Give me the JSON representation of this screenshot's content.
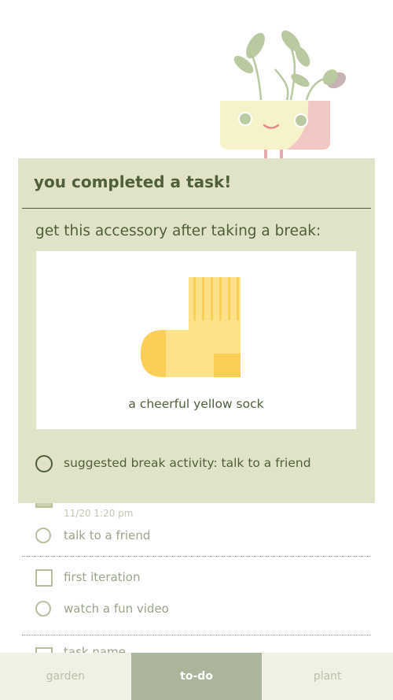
{
  "modal": {
    "title": "you completed a task!",
    "subtitle": "get this accessory after taking a break:",
    "accessory_name": "a cheerful yellow sock",
    "suggestion": "suggested break activity: talk to a friend"
  },
  "tasks": [
    {
      "timestamp": "11/20 1:20 pm",
      "subtask": "talk to a friend"
    },
    {
      "title": "first iteration",
      "subtask": "watch a fun video"
    },
    {
      "title": "task name"
    }
  ],
  "nav": {
    "tabs": [
      "garden",
      "to-do",
      "plant"
    ],
    "active": "to-do"
  },
  "colors": {
    "modal_bg": "#e0e3c8",
    "text_dark": "#4f5f3a",
    "nav_active": "#aab59c",
    "sock_yellow": "#fde08a",
    "sock_dark_yellow": "#f9cf55"
  },
  "icons": {
    "plant": "potted-plant-mascot",
    "sock": "yellow-sock"
  }
}
